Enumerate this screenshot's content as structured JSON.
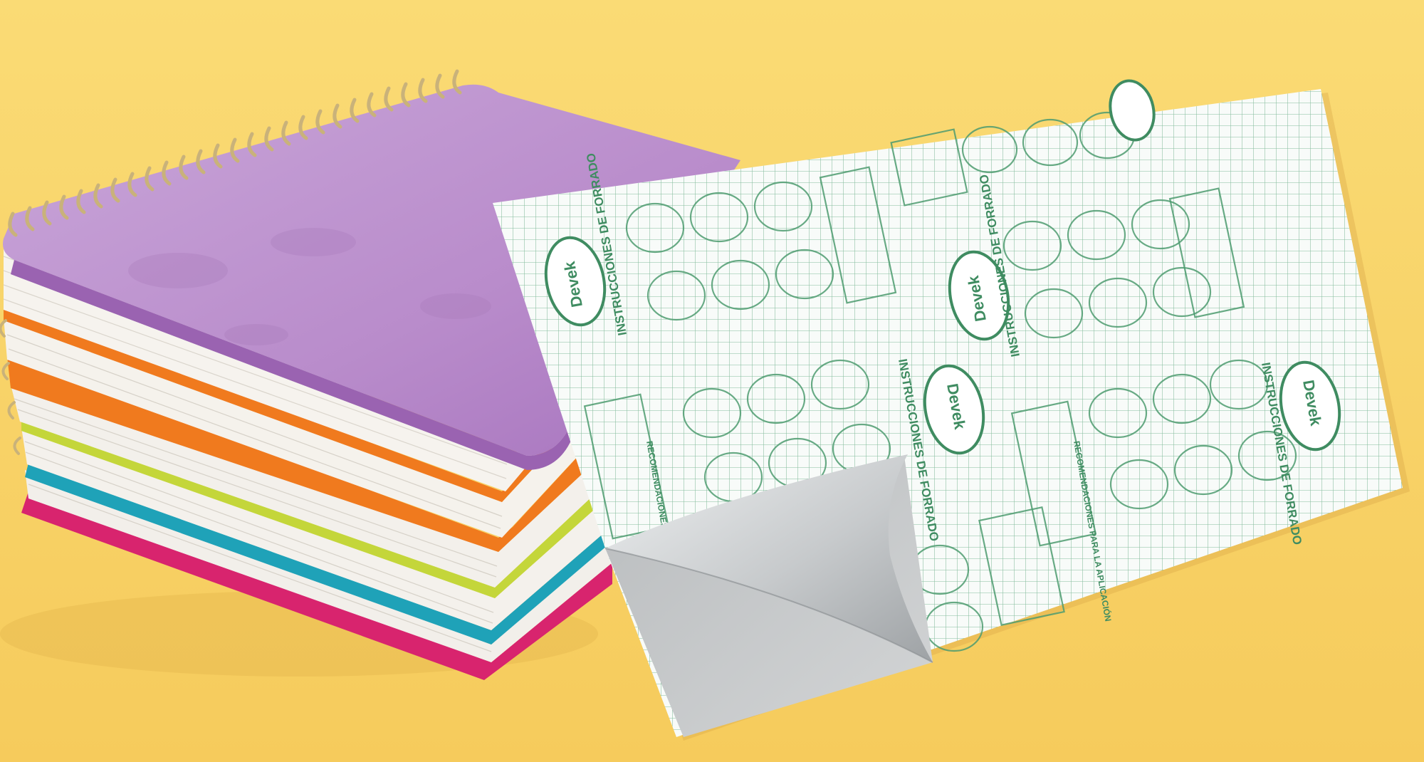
{
  "scene": {
    "background_color": "#F9D36A",
    "objects": [
      "stack-of-spiral-notebooks",
      "adhesive-book-cover-sheet"
    ]
  },
  "notebooks": {
    "cover_colors_top_to_bottom": [
      "#B98CCB",
      "#F07A1E",
      "#C4D63A",
      "#1FA2B8",
      "#D8246E"
    ],
    "pages_color": "#F3F0EA",
    "spiral_color": "#C9B27A"
  },
  "cover_sheet": {
    "grid_color": "#4E9B70",
    "sheet_color": "#F8FBF9",
    "peel_back_color": "#C9CBCC",
    "brand": "Devek",
    "heading": "INSTRUCCIONES DE FORRADO",
    "recommendations": "RECOMENDACIONES PARA LA APLICACIÓN"
  }
}
